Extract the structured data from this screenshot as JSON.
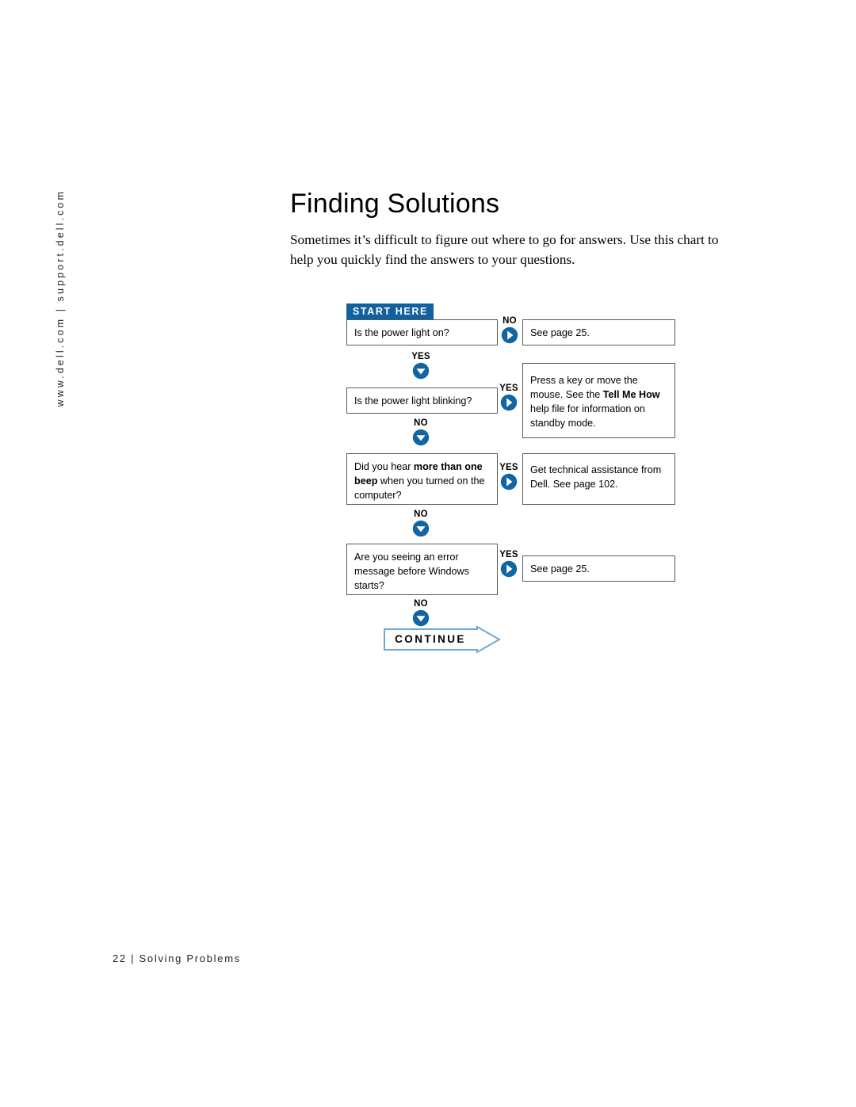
{
  "side_rail": {
    "url_text": "www.dell.com  |  support.dell.com"
  },
  "header": {
    "title": "Finding Solutions",
    "intro": "Sometimes it’s difficult to figure out where to go for answers. Use this chart to help you quickly find the answers to your questions."
  },
  "chart_data": {
    "type": "diagram",
    "title": "Finding Solutions",
    "start_label": "START HERE",
    "continue_label": "CONTINUE",
    "nodes": [
      {
        "id": "q1",
        "question": "Is the power light on?",
        "yes_label": "YES",
        "no_label": "NO",
        "branch_label": "NO",
        "answer": "See page 25."
      },
      {
        "id": "q2",
        "question": "Is the power light blinking?",
        "yes_label": "YES",
        "no_label": "NO",
        "branch_label": "YES",
        "answer_pre": "Press a key or move the mouse. See the ",
        "answer_bold": "Tell Me How",
        "answer_post": " help file for information on standby mode."
      },
      {
        "id": "q3",
        "question_pre": "Did you hear ",
        "question_bold1": "more than one",
        "question_mid": " ",
        "question_bold2": "beep",
        "question_post": " when you turned on the computer?",
        "branch_label": "YES",
        "answer": "Get technical assistance from Dell. See page 102."
      },
      {
        "id": "q4",
        "question": "Are you seeing an error message before Windows starts?",
        "branch_label": "YES",
        "answer": "See page 25."
      }
    ],
    "down_arrows": [
      "YES",
      "NO",
      "NO",
      "NO"
    ],
    "right_arrows": [
      "NO",
      "YES",
      "YES",
      "YES"
    ],
    "colors": {
      "accent_blue": "#12619f",
      "arrow_blue": "#1264a3",
      "continue_outline": "#6ea8d4",
      "box_border": "#58595b"
    }
  },
  "footer": {
    "page_number": "22",
    "separator": "|",
    "section": "Solving Problems",
    "text": "22  |   Solving Problems"
  }
}
